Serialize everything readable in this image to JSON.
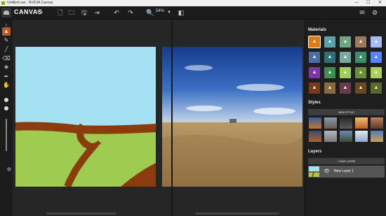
{
  "window": {
    "title": "Untitled.can - NVIDIA Canvas",
    "minimize": "—",
    "maximize": "☐",
    "close": "✕"
  },
  "toolbar": {
    "brand": "CANVAS",
    "beta": "BETA",
    "zoom": "54%"
  },
  "panels": {
    "materials": {
      "title": "Materials",
      "colors": [
        "#e07a18",
        "#5aa0a8",
        "#6fa582",
        "#9a7a5a",
        "#a8b8f0",
        "#4a6ea8",
        "#2e6f7a",
        "#7aa8a0",
        "#3c8f6a",
        "#5a83ff",
        "#7e36a8",
        "#3f8f50",
        "#9fcf5a",
        "#6a8f3a",
        "#a8d05a",
        "#7a3a1a",
        "#8a6a3a",
        "#6a3a4a",
        "#6a4a1a",
        "#5a6a2a"
      ]
    },
    "styles": {
      "title": "Styles",
      "new_style": "NEW STYLE"
    },
    "layers": {
      "title": "Layers",
      "add_layer": "+ ADD LAYER",
      "items": [
        {
          "name": "New Layer 1"
        }
      ]
    }
  },
  "colors": {
    "accent": "#76b900",
    "active_tool": "#c05a1a",
    "sky": "#a4e2f3",
    "grass": "#9dcc51",
    "wood": "#8b3c0f"
  }
}
